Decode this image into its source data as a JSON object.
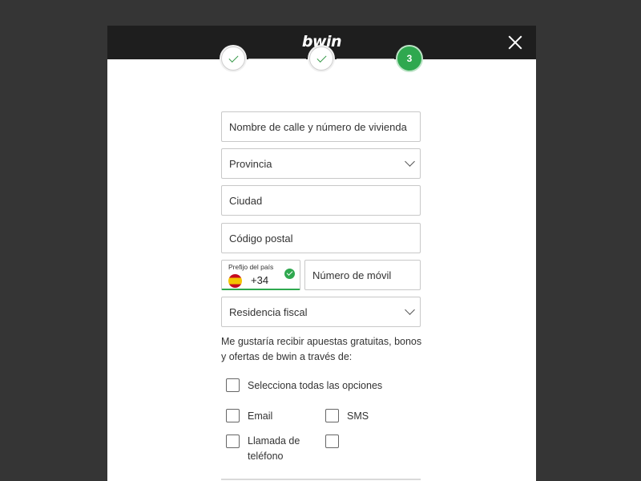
{
  "header": {
    "logo": "bwin"
  },
  "stepper": {
    "steps": [
      {
        "state": "done"
      },
      {
        "state": "done"
      },
      {
        "state": "active",
        "label": "3"
      }
    ]
  },
  "form": {
    "street": {
      "label": "Nombre de calle y número de vivienda"
    },
    "province": {
      "label": "Provincia"
    },
    "city": {
      "label": "Ciudad"
    },
    "postal": {
      "label": "Código postal"
    },
    "prefix": {
      "caption": "Prefijo del país",
      "value": "+34",
      "flag": "spain-flag-icon"
    },
    "mobile": {
      "label": "Número de móvil"
    },
    "tax_residence": {
      "label": "Residencia fiscal"
    }
  },
  "promo": {
    "text": "Me gustaría recibir apuestas gratuitas, bonos y ofertas de bwin a través de:",
    "select_all": "Selecciona todas las opciones",
    "email": "Email",
    "sms": "SMS",
    "phone_call": "Llamada de teléfono",
    "extra": ""
  },
  "colors": {
    "brand_green": "#2fa84f",
    "header_bg": "#1e1e1e",
    "backdrop": "#353535"
  }
}
